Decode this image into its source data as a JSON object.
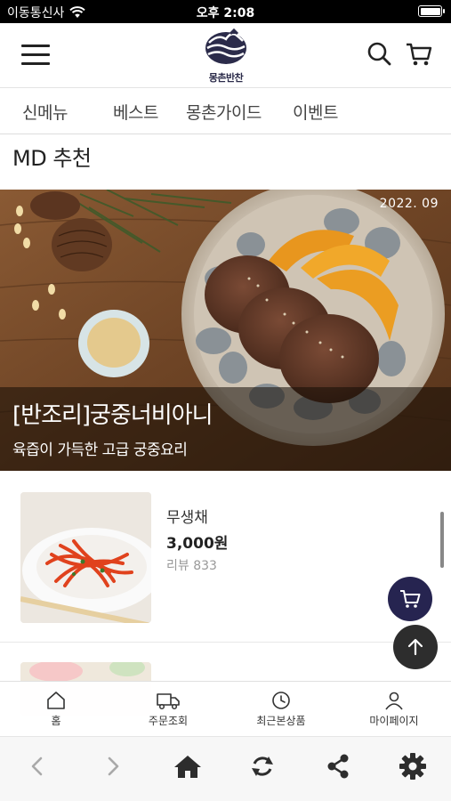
{
  "status_bar": {
    "carrier": "이동통신사",
    "time": "오후 2:08"
  },
  "header": {
    "brand": "몽촌반찬",
    "icons": [
      "hamburger-menu-icon",
      "search-icon",
      "cart-icon"
    ]
  },
  "tabs": [
    {
      "label": "신메뉴"
    },
    {
      "label": "베스트"
    },
    {
      "label": "몽촌가이드"
    },
    {
      "label": "이벤트"
    }
  ],
  "section_title": "MD 추천",
  "banner": {
    "date": "2022. 09",
    "title": "[반조리]궁중너비아니",
    "subtitle": "육즙이 가득한 고급 궁중요리"
  },
  "products": [
    {
      "name": "무생채",
      "price": "3,000원",
      "review": "리뷰 833"
    },
    {
      "name": "",
      "price": "",
      "review": ""
    }
  ],
  "bottom_nav": [
    {
      "label": "홈",
      "icon": "home-outline-icon"
    },
    {
      "label": "주문조회",
      "icon": "truck-icon"
    },
    {
      "label": "최근본상품",
      "icon": "clock-icon"
    },
    {
      "label": "마이페이지",
      "icon": "person-icon"
    }
  ],
  "browser_toolbar": [
    "back-icon",
    "forward-icon",
    "home-icon",
    "refresh-icon",
    "share-icon",
    "settings-icon"
  ],
  "colors": {
    "brand_navy": "#262450",
    "text_dark": "#222222",
    "review_gray": "#999999"
  }
}
